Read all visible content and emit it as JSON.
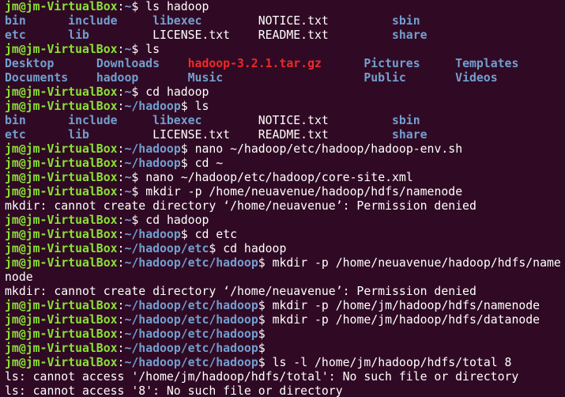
{
  "terminal": {
    "colors": {
      "background": "#300a24",
      "prompt_user": "#8ae234",
      "directory": "#729fcf",
      "archive": "#ef2929",
      "text": "#ffffff"
    },
    "lines": [
      {
        "kind": "prompt",
        "user": "jm@jm-VirtualBox",
        "path": "~",
        "command": "ls hadoop"
      },
      {
        "kind": "grid",
        "cols": [
          7,
          10,
          13,
          17,
          5
        ],
        "items": [
          {
            "t": "bin",
            "c": "dir"
          },
          {
            "t": "include",
            "c": "dir"
          },
          {
            "t": "libexec",
            "c": "dir"
          },
          {
            "t": "NOTICE.txt",
            "c": "file"
          },
          {
            "t": "sbin",
            "c": "dir"
          }
        ]
      },
      {
        "kind": "grid",
        "cols": [
          7,
          10,
          13,
          17,
          5
        ],
        "items": [
          {
            "t": "etc",
            "c": "dir"
          },
          {
            "t": "lib",
            "c": "dir"
          },
          {
            "t": "LICENSE.txt",
            "c": "file"
          },
          {
            "t": "README.txt",
            "c": "file"
          },
          {
            "t": "share",
            "c": "dir"
          }
        ]
      },
      {
        "kind": "prompt",
        "user": "jm@jm-VirtualBox",
        "path": "~",
        "command": "ls"
      },
      {
        "kind": "grid",
        "cols": [
          11,
          11,
          23,
          11,
          9
        ],
        "items": [
          {
            "t": "Desktop",
            "c": "dir"
          },
          {
            "t": "Downloads",
            "c": "dir"
          },
          {
            "t": "hadoop-3.2.1.tar.gz",
            "c": "archive"
          },
          {
            "t": "Pictures",
            "c": "dir"
          },
          {
            "t": "Templates",
            "c": "dir"
          }
        ]
      },
      {
        "kind": "grid",
        "cols": [
          11,
          11,
          23,
          11,
          9
        ],
        "items": [
          {
            "t": "Documents",
            "c": "dir"
          },
          {
            "t": "hadoop",
            "c": "dir"
          },
          {
            "t": "Music",
            "c": "dir"
          },
          {
            "t": "Public",
            "c": "dir"
          },
          {
            "t": "Videos",
            "c": "dir"
          }
        ]
      },
      {
        "kind": "prompt",
        "user": "jm@jm-VirtualBox",
        "path": "~",
        "command": "cd hadoop"
      },
      {
        "kind": "prompt",
        "user": "jm@jm-VirtualBox",
        "path": "~/hadoop",
        "command": "ls"
      },
      {
        "kind": "grid",
        "cols": [
          7,
          10,
          13,
          17,
          5
        ],
        "items": [
          {
            "t": "bin",
            "c": "dir"
          },
          {
            "t": "include",
            "c": "dir"
          },
          {
            "t": "libexec",
            "c": "dir"
          },
          {
            "t": "NOTICE.txt",
            "c": "file"
          },
          {
            "t": "sbin",
            "c": "dir"
          }
        ]
      },
      {
        "kind": "grid",
        "cols": [
          7,
          10,
          13,
          17,
          5
        ],
        "items": [
          {
            "t": "etc",
            "c": "dir"
          },
          {
            "t": "lib",
            "c": "dir"
          },
          {
            "t": "LICENSE.txt",
            "c": "file"
          },
          {
            "t": "README.txt",
            "c": "file"
          },
          {
            "t": "share",
            "c": "dir"
          }
        ]
      },
      {
        "kind": "prompt",
        "user": "jm@jm-VirtualBox",
        "path": "~/hadoop",
        "command": "nano ~/hadoop/etc/hadoop/hadoop-env.sh"
      },
      {
        "kind": "prompt",
        "user": "jm@jm-VirtualBox",
        "path": "~/hadoop",
        "command": "cd ~"
      },
      {
        "kind": "prompt",
        "user": "jm@jm-VirtualBox",
        "path": "~",
        "command": "nano ~/hadoop/etc/hadoop/core-site.xml"
      },
      {
        "kind": "prompt",
        "user": "jm@jm-VirtualBox",
        "path": "~",
        "command": "mkdir -p /home/neuavenue/hadoop/hdfs/namenode"
      },
      {
        "kind": "output",
        "text": "mkdir: cannot create directory ‘/home/neuavenue’: Permission denied"
      },
      {
        "kind": "prompt",
        "user": "jm@jm-VirtualBox",
        "path": "~",
        "command": "cd hadoop"
      },
      {
        "kind": "prompt",
        "user": "jm@jm-VirtualBox",
        "path": "~/hadoop",
        "command": "cd etc"
      },
      {
        "kind": "prompt",
        "user": "jm@jm-VirtualBox",
        "path": "~/hadoop/etc",
        "command": "cd hadoop"
      },
      {
        "kind": "prompt",
        "user": "jm@jm-VirtualBox",
        "path": "~/hadoop/etc/hadoop",
        "command": "mkdir -p /home/neuavenue/hadoop/hdfs/name"
      },
      {
        "kind": "output",
        "text": "node"
      },
      {
        "kind": "output",
        "text": "mkdir: cannot create directory ‘/home/neuavenue’: Permission denied"
      },
      {
        "kind": "prompt",
        "user": "jm@jm-VirtualBox",
        "path": "~/hadoop/etc/hadoop",
        "command": "mkdir -p /home/jm/hadoop/hdfs/namenode"
      },
      {
        "kind": "prompt",
        "user": "jm@jm-VirtualBox",
        "path": "~/hadoop/etc/hadoop",
        "command": "mkdir -p /home/jm/hadoop/hdfs/datanode"
      },
      {
        "kind": "prompt",
        "user": "jm@jm-VirtualBox",
        "path": "~/hadoop/etc/hadoop",
        "command": ""
      },
      {
        "kind": "prompt",
        "user": "jm@jm-VirtualBox",
        "path": "~/hadoop/etc/hadoop",
        "command": ""
      },
      {
        "kind": "prompt",
        "user": "jm@jm-VirtualBox",
        "path": "~/hadoop/etc/hadoop",
        "command": "ls -l /home/jm/hadoop/hdfs/total 8"
      },
      {
        "kind": "output",
        "text": "ls: cannot access '/home/jm/hadoop/hdfs/total': No such file or directory"
      },
      {
        "kind": "output",
        "text": "ls: cannot access '8': No such file or directory"
      }
    ]
  }
}
